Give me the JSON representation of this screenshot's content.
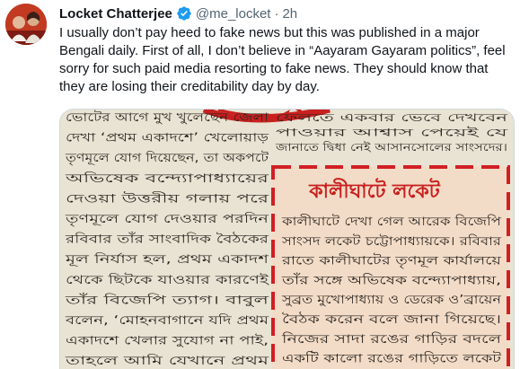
{
  "tweet": {
    "author_name": "Locket Chatterjee",
    "handle": "@me_locket",
    "separator": "·",
    "time": "2h",
    "text": "I usually don’t pay heed to fake news but this was published in a major Bengali daily. First of all, I don’t believe in “Aayaram Gayaram politics”, feel sorry for such paid media resorting to fake news. They should know that they are losing their creditability day by day."
  },
  "media": {
    "headline": "কালীঘাটে লকেট",
    "boxed_article_lines": [
      "কালীঘাটে দেখা গেল আরেক বিজেপি",
      "সাংসদ লকেট চট্টোপাধ্যায়কে। রবিবার",
      "রাতে কালীঘাটের তৃণমূল কার্যালয়ে",
      "তাঁর সঙ্গে অভিষেক বন্দ্যোপাধ্যায়,",
      "সুব্রত মুখোপাধ্যায় ও ডেরেক ও’ব্রায়েন",
      "বৈঠক করেন বলে জানা গিয়েছে।",
      "নিজের সাদা রঙের গাড়ির বদলে",
      "একটি কালো রঙের গাড়িতে লকেট"
    ],
    "column_lines": [
      "ভোটের আগে মুখ খুলেছেন জেলা",
      "দেখা ‘প্রথম একাদশে’ খেলোয়াড়",
      "তৃণমূলে যোগ দিয়েছেন, তা অকপটে",
      "অভিষেক বন্দ্যোপাধ্যায়ের",
      "দেওয়া উত্তরীয় গলায় পরে",
      "তৃণমূলে যোগ দেওয়ার পরদিন",
      "রবিবার তাঁর সাংবাদিক বৈঠকের",
      "মূল নির্যাস হল, প্রথম একাদশ",
      "থেকে ছিটকে যাওয়ার কারণেই",
      "তাঁর বিজেপি ত্যাগ। বাবুল",
      "বলেন, ‘মোহনবাগানে যদি প্রথম",
      "একাদশে খেলার সুযোগ না পাই,",
      "তাহলে আমি যেখানে প্রথম"
    ],
    "top_right_lines": [
      "ফেলতে একবার ভেবে দেখবেন",
      "পাওয়ার আশ্বাস পেয়েই যে",
      "জানাতে দ্বিধা নেই আসানসোলের সাংসদের।"
    ],
    "colors": {
      "paper": "#e9e3d3",
      "box_paper": "#f3dcc7",
      "dash_red": "#d11f24",
      "headline_red": "#c8201f",
      "ink": "#2a2521"
    }
  }
}
